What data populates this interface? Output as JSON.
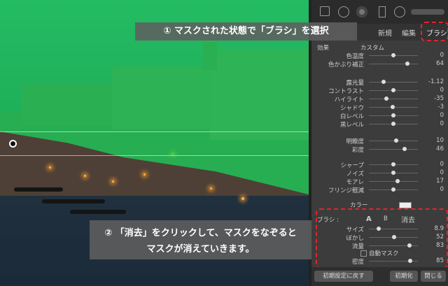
{
  "callouts": {
    "step1": "① マスクされた状態で「ブラシ」を選択",
    "step2_line1": "② 「消去」をクリックして、マスクをなぞると",
    "step2_line2": "マスクが消えていきます。"
  },
  "tabs": {
    "new": "新規",
    "edit": "編集",
    "brush": "ブラシ"
  },
  "effect": {
    "label": "効果",
    "value": "カスタム"
  },
  "sliders": [
    {
      "label": "色温度",
      "value": "0",
      "pos": 0.5
    },
    {
      "label": "色かぶり補正",
      "value": "64",
      "pos": 0.78
    },
    {
      "label": "露光量",
      "value": "-1.12",
      "pos": 0.3
    },
    {
      "label": "コントラスト",
      "value": "0",
      "pos": 0.5
    },
    {
      "label": "ハイライト",
      "value": "-35",
      "pos": 0.36
    },
    {
      "label": "シャドウ",
      "value": "-3",
      "pos": 0.49
    },
    {
      "label": "白レベル",
      "value": "0",
      "pos": 0.5
    },
    {
      "label": "黒レベル",
      "value": "0",
      "pos": 0.5
    },
    {
      "label": "明瞭度",
      "value": "10",
      "pos": 0.55
    },
    {
      "label": "彩度",
      "value": "46",
      "pos": 0.73
    },
    {
      "label": "シャープ",
      "value": "0",
      "pos": 0.5
    },
    {
      "label": "ノイズ",
      "value": "0",
      "pos": 0.5
    },
    {
      "label": "モアレ",
      "value": "17",
      "pos": 0.58
    },
    {
      "label": "フリンジ軽減",
      "value": "0",
      "pos": 0.5
    }
  ],
  "color_label": "カラー",
  "brush": {
    "label": "ブラシ :",
    "a": "A",
    "b": "B",
    "erase": "消去",
    "size_label": "サイズ",
    "size_value": "8.9",
    "size_pos": 0.2,
    "feather_label": "ぼかし",
    "feather_value": "52",
    "feather_pos": 0.52,
    "flow_label": "流量",
    "flow_value": "83",
    "flow_pos": 0.83,
    "automask_label": "自動マスク",
    "density_label": "密度",
    "density_value": "85",
    "density_pos": 0.85
  },
  "footer": {
    "reset": "初期設定に戻す",
    "init": "初期化",
    "close": "閉じる"
  },
  "colors": {
    "mask": "#1ccd5a",
    "highlight": "#e4232b"
  }
}
